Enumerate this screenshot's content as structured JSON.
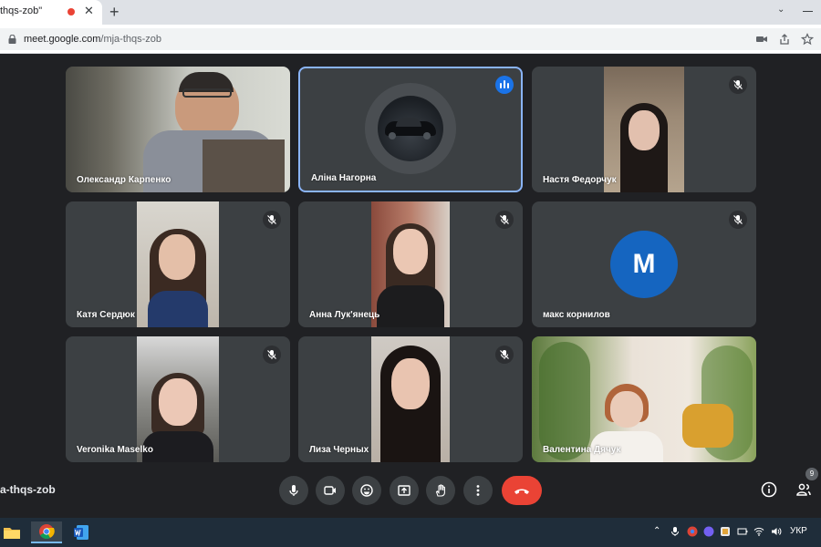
{
  "browser": {
    "tab_title": "thqs-zob\"",
    "new_tab_symbol": "+",
    "close_symbol": "✕",
    "url_host": "meet.google.com",
    "url_path": "/mja-thqs-zob"
  },
  "meeting": {
    "code": "a-thqs-zob",
    "participant_count": "9"
  },
  "participants": [
    {
      "name": "Олександр Карпенко",
      "muted": false,
      "speaking": false
    },
    {
      "name": "Аліна Нагорна",
      "muted": false,
      "speaking": true
    },
    {
      "name": "Настя Федорчук",
      "muted": true,
      "speaking": false
    },
    {
      "name": "Катя Сердюк",
      "muted": true,
      "speaking": false
    },
    {
      "name": "Анна Лук'янець",
      "muted": true,
      "speaking": false
    },
    {
      "name": "макс корнилов",
      "muted": true,
      "speaking": false,
      "avatar_letter": "M",
      "avatar_color": "#1565c0"
    },
    {
      "name": "Veronika Maselko",
      "muted": true,
      "speaking": false
    },
    {
      "name": "Лиза Черных",
      "muted": true,
      "speaking": false
    },
    {
      "name": "Валентина Дячук",
      "muted": false,
      "speaking": false
    }
  ],
  "controls": [
    "mic-icon",
    "camera-icon",
    "emoji-icon",
    "present-icon",
    "raise-hand-icon",
    "more-options-icon",
    "end-call-icon"
  ],
  "taskbar": {
    "language": "УКР"
  },
  "colors": {
    "stage_bg": "#202124",
    "tile_bg": "#3c4043",
    "active_border": "#8ab4f8",
    "end_call": "#ea4335",
    "speaking_badge": "#1a73e8"
  }
}
